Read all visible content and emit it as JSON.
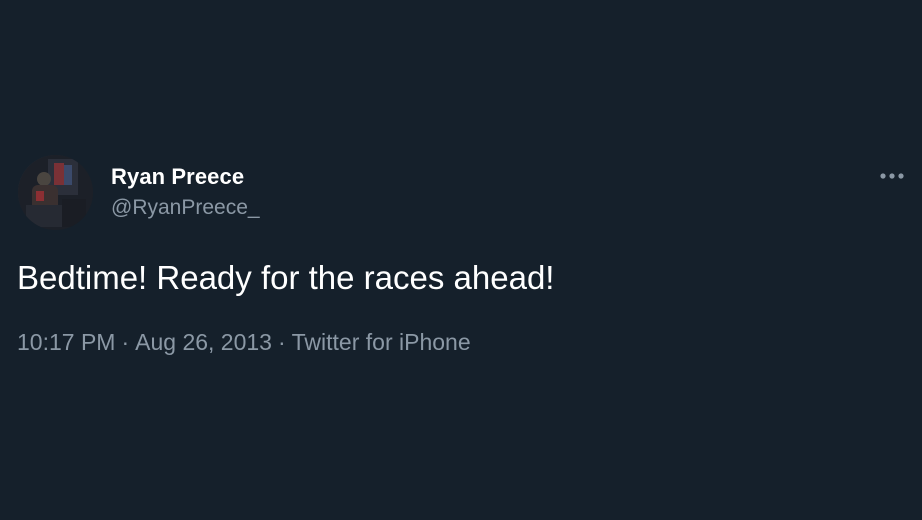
{
  "author": {
    "display_name": "Ryan Preece",
    "handle": "@RyanPreece_",
    "avatar_icon": "profile-photo"
  },
  "tweet": {
    "text": "Bedtime! Ready for the races ahead!",
    "time": "10:17 PM",
    "date": "Aug 26, 2013",
    "source": "Twitter for iPhone",
    "separator": "·"
  },
  "actions": {
    "more_icon": "more-horizontal-icon"
  },
  "colors": {
    "background": "#15202b",
    "primary_text": "#ffffff",
    "secondary_text": "#8b98a5"
  }
}
